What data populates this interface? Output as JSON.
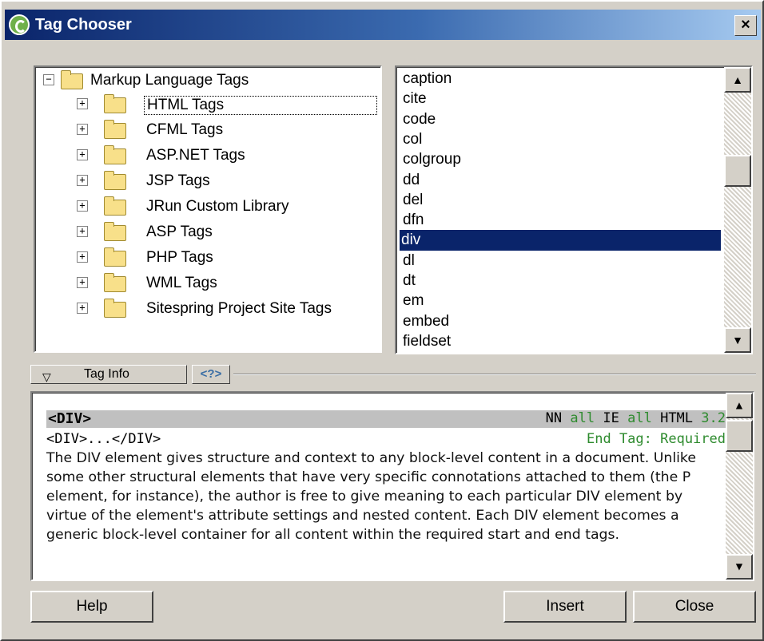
{
  "window": {
    "title": "Tag Chooser",
    "close_glyph": "×"
  },
  "tree": {
    "root": {
      "label": "Markup Language Tags",
      "expander": "−"
    },
    "children": [
      {
        "label": "HTML Tags",
        "expander": "+"
      },
      {
        "label": "CFML Tags",
        "expander": "+"
      },
      {
        "label": "ASP.NET Tags",
        "expander": "+"
      },
      {
        "label": "JSP Tags",
        "expander": "+"
      },
      {
        "label": "JRun Custom Library",
        "expander": "+"
      },
      {
        "label": "ASP Tags",
        "expander": "+"
      },
      {
        "label": "PHP Tags",
        "expander": "+"
      },
      {
        "label": "WML Tags",
        "expander": "+"
      },
      {
        "label": "Sitespring Project Site Tags",
        "expander": "+"
      }
    ]
  },
  "tag_list": {
    "items": [
      "caption",
      "cite",
      "code",
      "col",
      "colgroup",
      "dd",
      "del",
      "dfn",
      "div",
      "dl",
      "dt",
      "em",
      "embed",
      "fieldset"
    ],
    "selected": "div"
  },
  "panel": {
    "tab_label": "Tag Info",
    "collapse_glyph": "▽",
    "help_glyph": "<?>"
  },
  "info": {
    "tag": "<DIV>",
    "nn": "NN",
    "nn_val": "all",
    "ie": "IE",
    "ie_val": "all",
    "html": "HTML",
    "html_val": "3.2",
    "syntax": "<DIV>...</DIV>",
    "end_tag": "End Tag: Required",
    "description": "The DIV element gives structure and context to any block-level content in a document. Unlike some other structural elements that have very specific connotations attached to them (the P element, for instance), the author is free to give meaning to each particular DIV element by virtue of the element's attribute settings and nested content. Each DIV element becomes a generic block-level container for all content within the required start and end tags."
  },
  "buttons": {
    "help": "Help",
    "insert": "Insert",
    "close": "Close"
  },
  "scroll": {
    "up": "▲",
    "down": "▼"
  }
}
